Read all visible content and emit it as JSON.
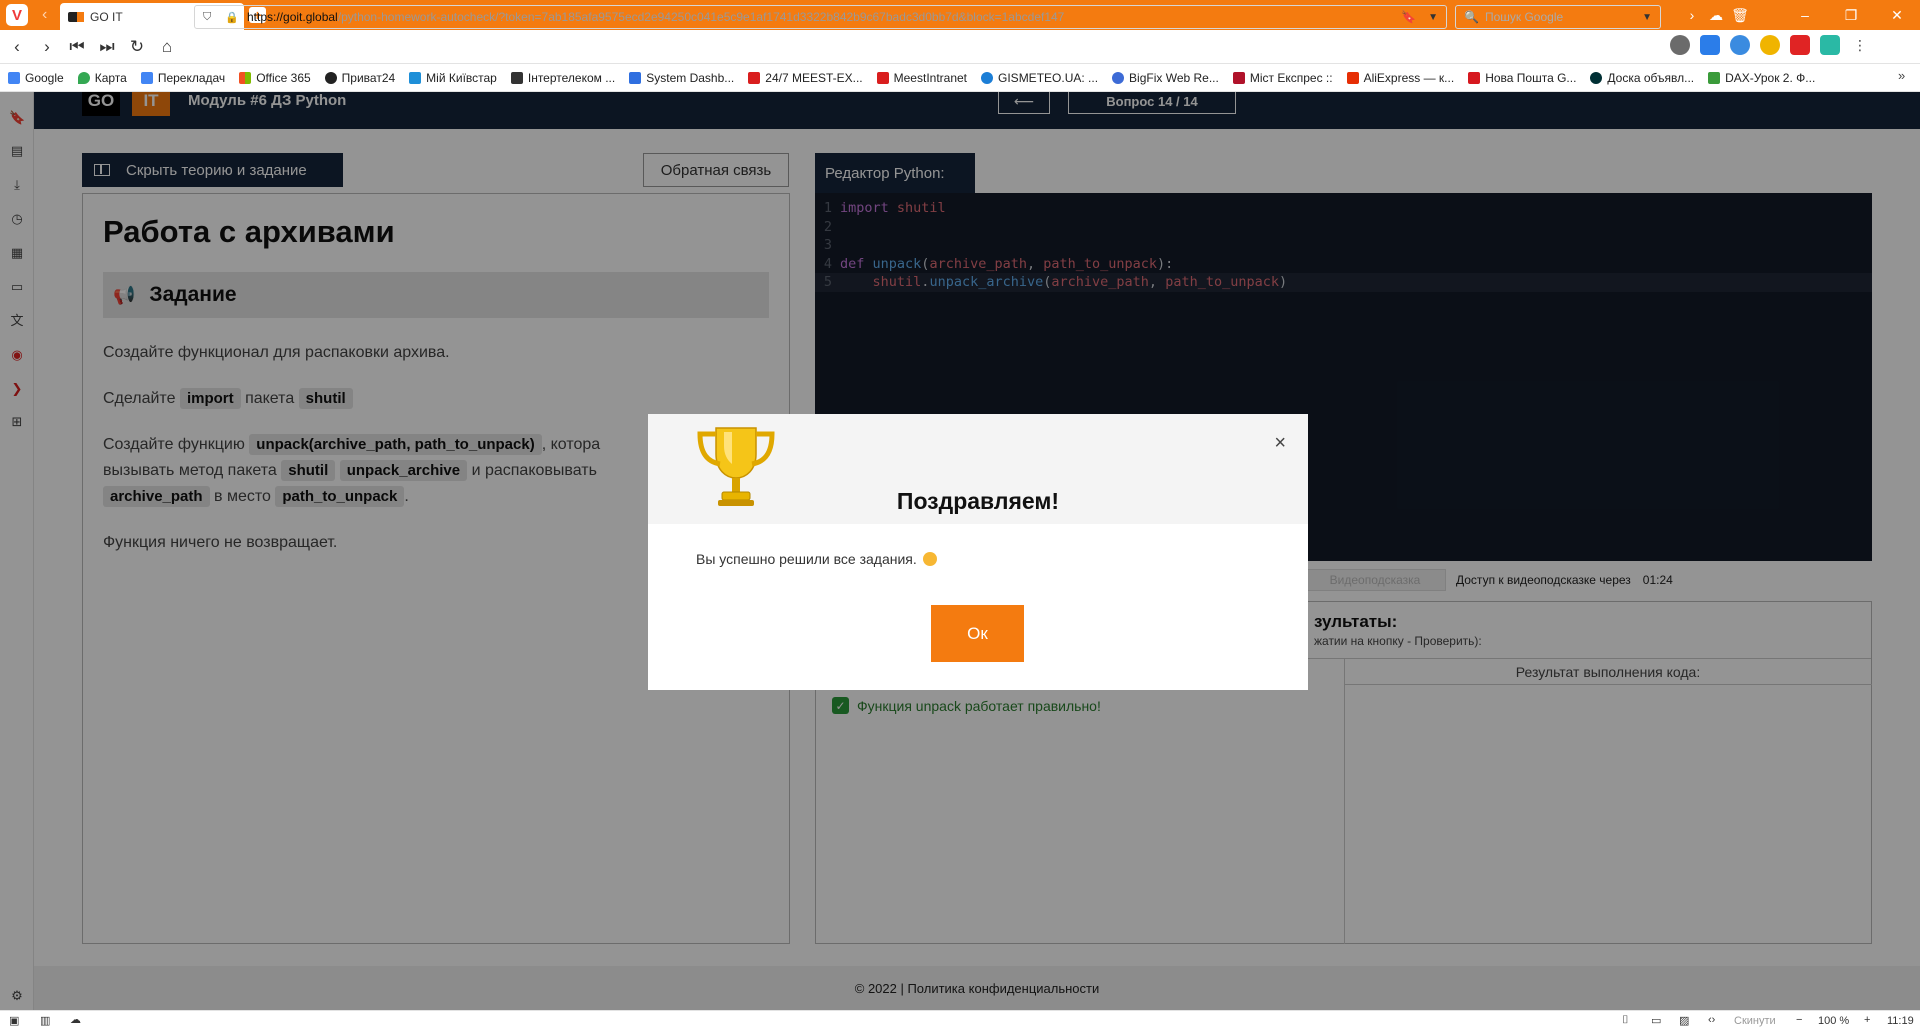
{
  "browser": {
    "tab_title": "GO IT",
    "url_host": "https://goit.global",
    "url_path": "/python-homework-autocheck/?token=7ab185afa9575ecd2e94250c041e5c9e1af1741d3322b842b9c67badc3d0bb7d&block=1abcdef147",
    "search_placeholder": "Пошук Google",
    "bookmarks": [
      "Google",
      "Карта",
      "Перекладач",
      "Office 365",
      "Приват24",
      "Мій Київстар",
      "Інтертелеком ...",
      "System Dashb...",
      "24/7 MEEST-EX...",
      "MeestIntranet",
      "GISMETEO.UA: ...",
      "BigFix Web Re...",
      "Міст Експрес ::",
      "AliExpress — к...",
      "Нова Пошта G...",
      "Доска объявл...",
      "DAX-Урок 2. Ф..."
    ],
    "status": {
      "collapse_label": "Скинути",
      "zoom": "100 %",
      "time": "11:19"
    }
  },
  "page": {
    "module_title": "Модуль #6 ДЗ Python",
    "logo_go": "GO",
    "logo_it": "IT",
    "prev_arrow": "⟵",
    "question_counter": "Вопрос 14 / 14",
    "hide_button": "Скрыть теорию и задание",
    "feedback_button": "Обратная связь",
    "task_title": "Работа с архивами",
    "task_section": "Задание",
    "p1": "Создайте функционал для распаковки архива.",
    "p2_a": "Сделайте",
    "p2_code1": "import",
    "p2_b": "пакета",
    "p2_code2": "shutil",
    "p3_a": "Создайте функцию",
    "p3_code1": "unpack(archive_path, path_to_unpack)",
    "p3_b": ", котора",
    "p3_c": "вызывать метод пакета",
    "p3_code2": "shutil",
    "p3_code3": "unpack_archive",
    "p3_d": "и распаковывать",
    "p3_code4": "archive_path",
    "p3_e": "в место",
    "p3_code5": "path_to_unpack",
    "p3_f": ".",
    "p4": "Функция ничего не возвращает.",
    "editor_tab": "Редактор Python:",
    "code_lines": [
      {
        "num": "1",
        "parts": [
          [
            "kw",
            "import "
          ],
          [
            "mod",
            "shutil"
          ]
        ]
      },
      {
        "num": "2",
        "parts": []
      },
      {
        "num": "3",
        "parts": []
      },
      {
        "num": "4",
        "parts": [
          [
            "kw",
            "def "
          ],
          [
            "fn",
            "unpack"
          ],
          [
            "pl",
            "("
          ],
          [
            "pr",
            "archive_path"
          ],
          [
            "pl",
            ", "
          ],
          [
            "pr",
            "path_to_unpack"
          ],
          [
            "pl",
            "):"
          ]
        ]
      },
      {
        "num": "5",
        "parts": [
          [
            "pl",
            "    "
          ],
          [
            "mod",
            "shutil"
          ],
          [
            "pl",
            "."
          ],
          [
            "fn",
            "unpack_archive"
          ],
          [
            "pl",
            "("
          ],
          [
            "pr",
            "archive_path"
          ],
          [
            "pl",
            ", "
          ],
          [
            "pr",
            "path_to_unpack"
          ],
          [
            "pl",
            ")"
          ]
        ]
      }
    ],
    "hint_button": "Видеоподсказка",
    "hint_text": "Доступ к видеоподсказке через",
    "hint_timer": "01:24",
    "results_title": "зультаты:",
    "results_sub": "жатии на кнопку - Проверить):",
    "result_column_title": "Результат выполнения кода:",
    "check_message": "Функция unpack работает правильно!",
    "footer": "© 2022  |  Политика конфиденциальности"
  },
  "modal": {
    "title": "Поздравляем!",
    "body": "Вы успешно решили все задания.",
    "ok_button": "Ок",
    "close_icon": "×"
  },
  "colors": {
    "accent": "#f47b10",
    "navy": "#15253b",
    "editor_bg": "#131b29",
    "success": "#2a9a3a"
  }
}
